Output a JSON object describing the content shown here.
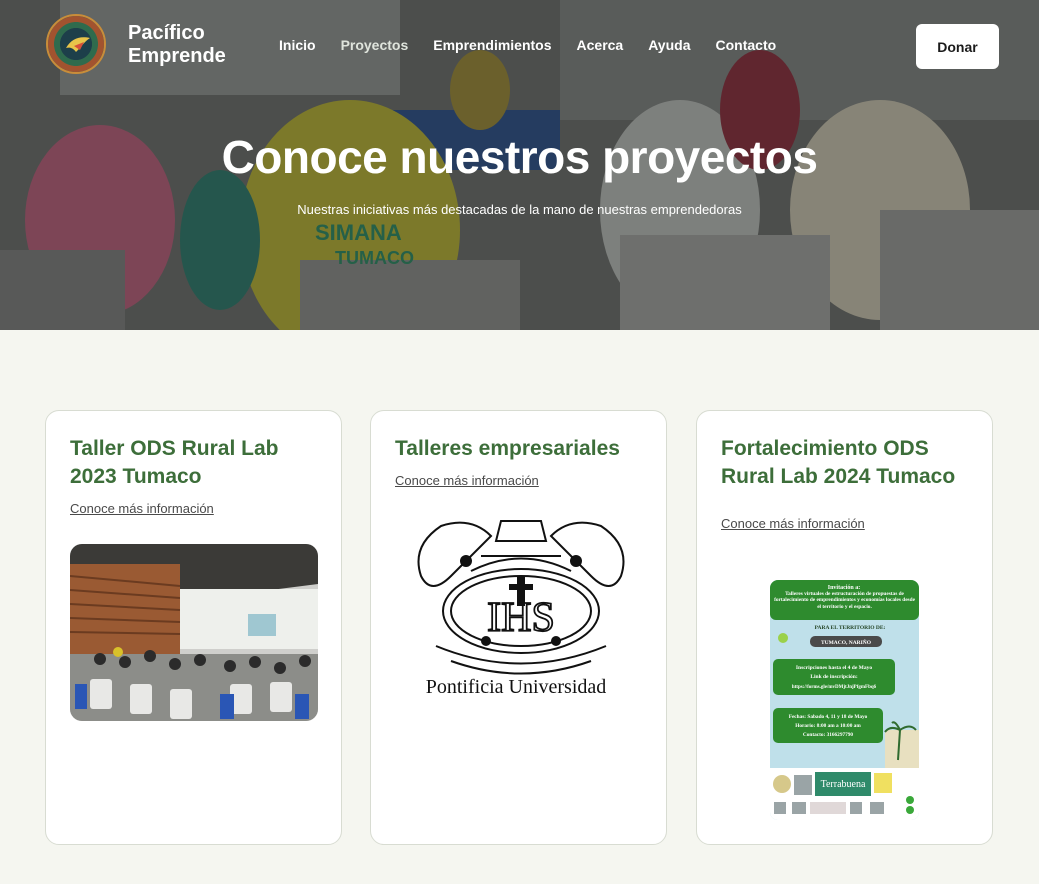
{
  "header": {
    "brand_line1": "Pacífico",
    "brand_line2": "Emprende",
    "nav": [
      {
        "label": "Inicio"
      },
      {
        "label": "Proyectos"
      },
      {
        "label": "Emprendimientos"
      },
      {
        "label": "Acerca"
      },
      {
        "label": "Ayuda"
      },
      {
        "label": "Contacto"
      }
    ],
    "donate_label": "Donar"
  },
  "hero": {
    "title": "Conoce nuestros proyectos",
    "subtitle": "Nuestras iniciativas más destacadas de la mano de nuestras emprendedoras",
    "shirt_text_1": "SIMANA",
    "shirt_text_2": "TUMACO"
  },
  "cards": [
    {
      "title": "Taller ODS Rural Lab 2023 Tumaco",
      "link": "Conoce más información"
    },
    {
      "title": "Talleres empresariales",
      "link": "Conoce más información",
      "image_caption": "Pontificia Universidad",
      "seal_text": "IHS"
    },
    {
      "title": "Fortalecimiento ODS Rural Lab 2024 Tumaco",
      "link": "Conoce más información",
      "flyer": {
        "heading": "Invitación a:",
        "intro": "Talleres virtuales de estructuración de propuestas de fortalecimiento de emprendimientos y economías locales desde el territorio y el espacio.",
        "territory_label": "PARA EL TERRITORIO DE:",
        "territory": "TUMACO, NARIÑO",
        "registration": "Inscripciones hasta el 4 de Mayo",
        "link_label": "Link de inscripción:",
        "link_url": "https://forms.gle/mvDMjtJnjPfgmFbq6",
        "dates": "Fechas: Sabado 4, 11 y 18 de Mayo",
        "hours": "Horario: 8:00 am a 10:00 am",
        "contact": "Contacto: 3166297790",
        "sponsor": "Terrabuena"
      }
    }
  ],
  "colors": {
    "accent": "#3d6e3a",
    "page_bg": "#f5f6f0",
    "flyer_green": "#2e8b2e"
  }
}
